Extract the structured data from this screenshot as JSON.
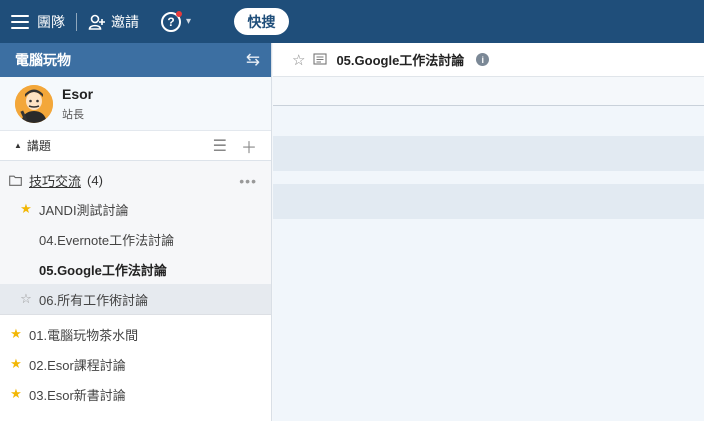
{
  "topbar": {
    "team_label": "團隊",
    "invite_label": "邀請",
    "help_icon": "question-circle-icon",
    "quick_search_label": "快搜",
    "colors": {
      "bar": "#1f4e7a",
      "notification_dot": "#e63b3b"
    }
  },
  "sidebar": {
    "team_name": "電腦玩物",
    "profile": {
      "name": "Esor",
      "role": "站長"
    },
    "topics_label": "講題",
    "folder": {
      "name": "技巧交流",
      "count": "(4)"
    },
    "folder_topics": [
      {
        "label": "JANDI測試討論",
        "starred": true,
        "bold": false,
        "selected": false
      },
      {
        "label": "04.Evernote工作法討論",
        "starred": false,
        "bold": false,
        "selected": false
      },
      {
        "label": "05.Google工作法討論",
        "starred": false,
        "bold": true,
        "selected": false
      },
      {
        "label": "06.所有工作術討論",
        "starred": false,
        "bold": false,
        "selected": true
      }
    ],
    "topics": [
      {
        "label": "01.電腦玩物茶水間",
        "starred": true
      },
      {
        "label": "02.Esor課程討論",
        "starred": true
      },
      {
        "label": "03.Esor新書討論",
        "starred": true
      }
    ],
    "colors": {
      "header": "#3c6fa2",
      "star": "#f2b705"
    }
  },
  "main": {
    "topic_title": "05.Google工作法討論"
  }
}
